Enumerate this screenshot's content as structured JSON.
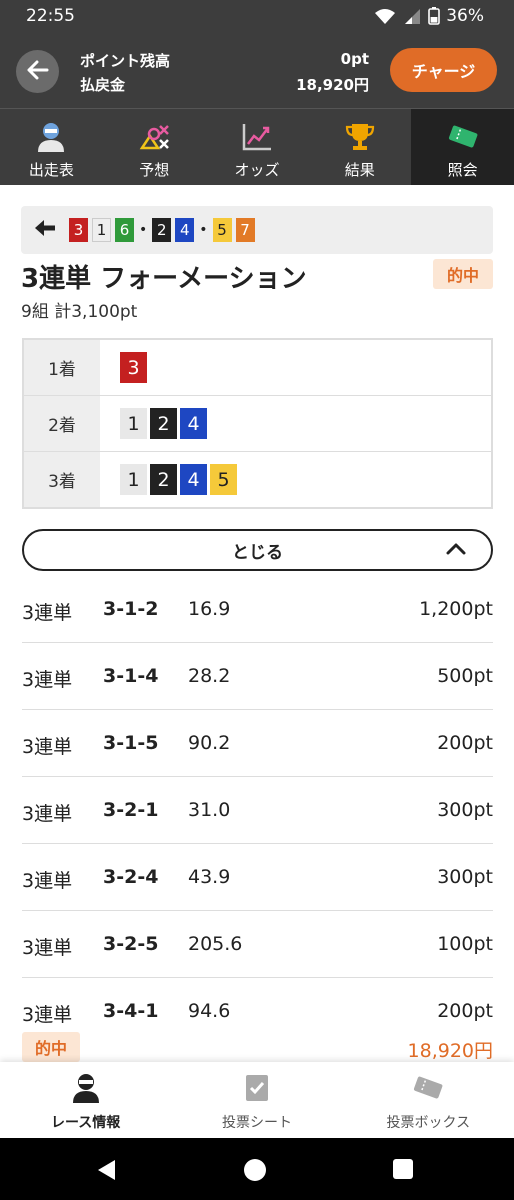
{
  "status_bar": {
    "time": "22:55",
    "battery": "36%"
  },
  "points_header": {
    "points_label": "ポイント残高",
    "payout_label": "払戻金",
    "points_value": "0pt",
    "payout_value": "18,920円",
    "charge_button": "チャージ"
  },
  "nav_tabs": [
    {
      "label": "出走表",
      "icon": "racer-icon"
    },
    {
      "label": "予想",
      "icon": "prediction-icon"
    },
    {
      "label": "オッズ",
      "icon": "odds-chart-icon"
    },
    {
      "label": "結果",
      "icon": "trophy-icon"
    },
    {
      "label": "照会",
      "icon": "ticket-icon",
      "active": true
    }
  ],
  "breadcrumb": {
    "back_icon": "back-arrow-icon",
    "chips": [
      "3",
      "1",
      "6",
      "2",
      "4",
      "5",
      "7"
    ],
    "separator": "•"
  },
  "bet": {
    "title": "3連単 フォーメーション",
    "status": "的中",
    "summary": "9組 計3,100pt"
  },
  "formation": [
    {
      "place": "1着",
      "numbers": [
        "3"
      ]
    },
    {
      "place": "2着",
      "numbers": [
        "1",
        "2",
        "4"
      ]
    },
    {
      "place": "3着",
      "numbers": [
        "1",
        "2",
        "4",
        "5"
      ]
    }
  ],
  "close_button": "とじる",
  "combinations": [
    {
      "type": "3連単",
      "combo": "3-1-2",
      "odds": "16.9",
      "amount": "1,200pt"
    },
    {
      "type": "3連単",
      "combo": "3-1-4",
      "odds": "28.2",
      "amount": "500pt"
    },
    {
      "type": "3連単",
      "combo": "3-1-5",
      "odds": "90.2",
      "amount": "200pt"
    },
    {
      "type": "3連単",
      "combo": "3-2-1",
      "odds": "31.0",
      "amount": "300pt"
    },
    {
      "type": "3連単",
      "combo": "3-2-4",
      "odds": "43.9",
      "amount": "300pt"
    },
    {
      "type": "3連単",
      "combo": "3-2-5",
      "odds": "205.6",
      "amount": "100pt"
    },
    {
      "type": "3連単",
      "combo": "3-4-1",
      "odds": "94.6",
      "amount": "200pt"
    }
  ],
  "total": {
    "status": "的中",
    "amount": "18,920円"
  },
  "bottom_nav": [
    {
      "label": "レース情報",
      "icon": "racer-icon",
      "active": true
    },
    {
      "label": "投票シート",
      "icon": "checksheet-icon"
    },
    {
      "label": "投票ボックス",
      "icon": "ticket-icon"
    }
  ],
  "colors": {
    "header_bg": "#3d3d3d",
    "accent_orange": "#e06c27",
    "hit_badge_bg": "#fce6d4",
    "lane_1": "#e8e8e8",
    "lane_2": "#222222",
    "lane_3": "#c42020",
    "lane_4": "#1e47c2",
    "lane_5": "#f5c93a",
    "lane_6": "#2f9a3a",
    "lane_7": "#e27a26"
  }
}
